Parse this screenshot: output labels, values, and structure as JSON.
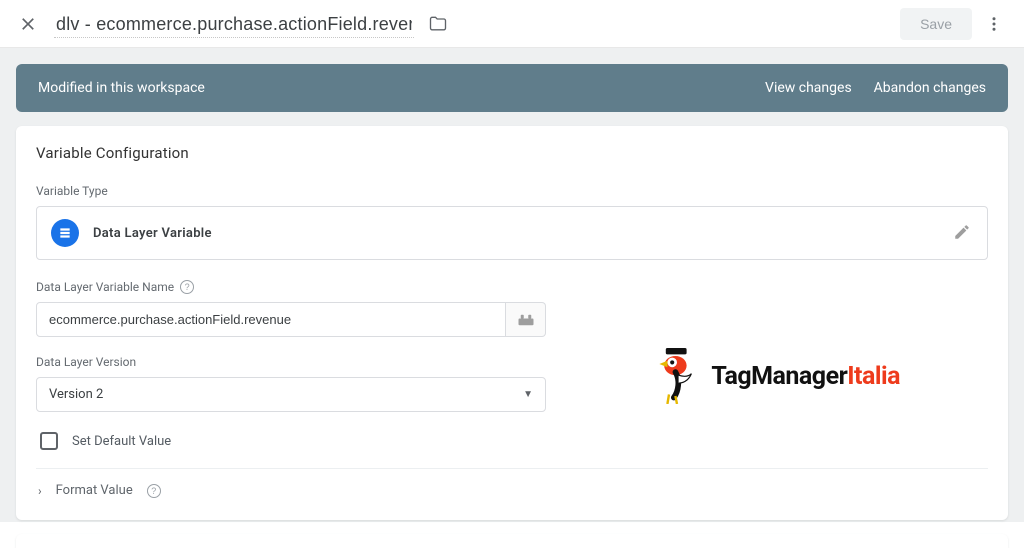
{
  "topbar": {
    "title": "dlv - ecommerce.purchase.actionField.revenue",
    "save_label": "Save"
  },
  "banner": {
    "message": "Modified in this workspace",
    "view_changes": "View changes",
    "abandon_changes": "Abandon changes"
  },
  "card": {
    "title": "Variable Configuration",
    "variable_type_label": "Variable Type",
    "variable_type_name": "Data Layer Variable",
    "dlv_name_label": "Data Layer Variable Name",
    "dlv_name_value": "ecommerce.purchase.actionField.revenue",
    "dlv_version_label": "Data Layer Version",
    "dlv_version_value": "Version 2",
    "set_default_label": "Set Default Value",
    "format_value_label": "Format Value"
  },
  "logo": {
    "brand1": "TagManager",
    "brand2": "Italia"
  }
}
